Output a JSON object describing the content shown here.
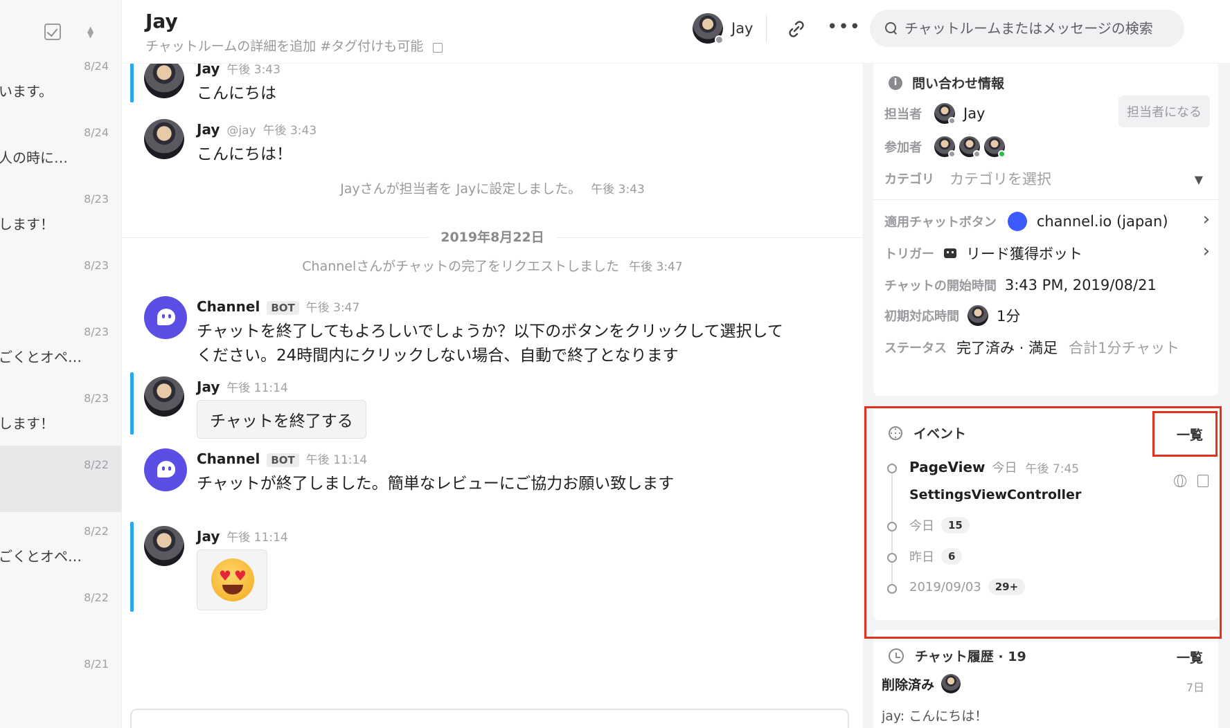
{
  "left_list": {
    "items": [
      {
        "date": "8/24",
        "snippet": "います。"
      },
      {
        "date": "8/24",
        "snippet": "人の時に…"
      },
      {
        "date": "8/23",
        "snippet": "します！"
      },
      {
        "date": "8/23",
        "snippet": ""
      },
      {
        "date": "8/23",
        "snippet": "ごくとオペ…"
      },
      {
        "date": "8/23",
        "snippet": "します！"
      },
      {
        "date": "8/22",
        "snippet": ""
      },
      {
        "date": "8/22",
        "snippet": "ごくとオペ…"
      },
      {
        "date": "8/22",
        "snippet": ""
      },
      {
        "date": "8/21",
        "snippet": ""
      }
    ]
  },
  "header": {
    "title": "Jay",
    "description": "チャットルームの詳細を追加 #タグ付けも可能",
    "user_name": "Jay",
    "more_label": "•••",
    "search_placeholder": "チャットルームまたはメッセージの検索"
  },
  "messages": [
    {
      "name": "Jay",
      "handle": "",
      "time": "午後 3:43",
      "text": "こんにちは"
    },
    {
      "name": "Jay",
      "handle": "@jay",
      "time": "午後 3:43",
      "text": "こんにちは！"
    },
    {
      "name": "Channel",
      "badge": "BOT",
      "time": "午後 3:47",
      "text": "チャットを終了してもよろしいでしょうか？以下のボタンをクリックして選択してください。24時間内にクリックしない場合、自動で終了となります"
    },
    {
      "name": "Jay",
      "time": "午後 11:14",
      "button": "チャットを終了する"
    },
    {
      "name": "Channel",
      "badge": "BOT",
      "time": "午後 11:14",
      "text": "チャットが終了しました。簡単なレビューにご協力お願い致します"
    },
    {
      "name": "Jay",
      "time": "午後 11:14"
    }
  ],
  "system_messages": [
    {
      "text": "Jayさんが担当者を Jayに設定しました。",
      "time": "午後 3:43"
    },
    {
      "text": "Channelさんがチャットの完了をリクエストしました",
      "time": "午後 3:47"
    }
  ],
  "date_separator": "2019年8月22日",
  "info": {
    "title": "問い合わせ情報",
    "assignee_label": "担当者",
    "assignee_name": "Jay",
    "assignee_button": "担当者になる",
    "participants_label": "参加者",
    "category_label": "カテゴリ",
    "category_placeholder": "カテゴリを選択",
    "button_label": "適用チャットボタン",
    "button_value": "channel.io (japan)",
    "trigger_label": "トリガー",
    "trigger_value": "リード獲得ボット",
    "start_label": "チャットの開始時間",
    "start_value": "3:43 PM, 2019/08/21",
    "first_response_label": "初期対応時間",
    "first_response_value": "1分",
    "status_label": "ステータス",
    "status_value": "完了済み · 満足",
    "status_total": "合計1分チャット",
    "accent_color": "#3d5afe"
  },
  "events": {
    "title": "イベント",
    "list_link": "一覧",
    "latest": {
      "name": "PageView",
      "day": "今日",
      "time": "午後 7:45",
      "path": "SettingsViewController"
    },
    "groups": [
      {
        "label": "今日",
        "count": "15"
      },
      {
        "label": "昨日",
        "count": "6"
      },
      {
        "label": "2019/09/03",
        "count": "29+"
      }
    ],
    "highlight_color": "#e0321f"
  },
  "history": {
    "title": "チャット履歴 · 19",
    "list_link": "一覧",
    "status": "削除済み",
    "ago": "7日",
    "snippet": "jay: こんにちは！"
  }
}
